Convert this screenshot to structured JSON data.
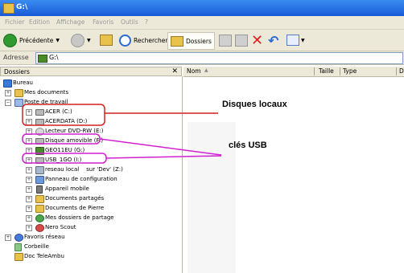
{
  "window": {
    "title": "G:\\"
  },
  "menu": [
    "Fichier",
    "Edition",
    "Affichage",
    "Favoris",
    "Outils",
    "?"
  ],
  "toolbar": {
    "back": "Précédente",
    "search": "Rechercher",
    "folders": "Dossiers"
  },
  "address": {
    "label": "Adresse",
    "value": "G:\\"
  },
  "folders_pane": {
    "title": "Dossiers",
    "close": "✕",
    "tree": [
      {
        "label": "Bureau"
      },
      {
        "label": "Mes documents"
      },
      {
        "label": "Poste de travail"
      },
      {
        "label": "ACER (C:)"
      },
      {
        "label": "ACERDATA (D:)"
      },
      {
        "label": "Lecteur DVD-RW (E:)"
      },
      {
        "label": "Disque amovible (F:)"
      },
      {
        "label": "GEO11EU (G:)"
      },
      {
        "label": "USB_1GO (I:)"
      },
      {
        "label": "reseau local    sur 'Dev' (Z:)"
      },
      {
        "label": "Panneau de configuration"
      },
      {
        "label": "Appareil mobile"
      },
      {
        "label": "Documents partagés"
      },
      {
        "label": "Documents de Pierre"
      },
      {
        "label": "Mes dossiers de partage"
      },
      {
        "label": "Nero Scout"
      },
      {
        "label": "Favoris réseau"
      },
      {
        "label": "Corbeille"
      },
      {
        "label": "Doc TeleAmbu"
      }
    ]
  },
  "columns": [
    "Nom",
    "Taille",
    "Type",
    "D"
  ],
  "annotations": {
    "local": "Disques locaux",
    "usb": "clés USB"
  },
  "colors": {
    "local": "#d42020",
    "usb": "#d020d0"
  }
}
